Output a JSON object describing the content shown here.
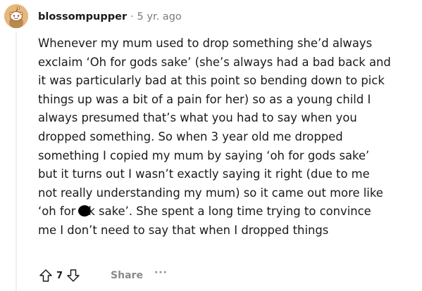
{
  "comment": {
    "username": "blossompupper",
    "separator": "·",
    "timestamp": "5 yr. ago",
    "avatar_icon": "snoo-avatar-icon",
    "body_lines": [
      "Whenever my mum used to drop something she’d always",
      "exclaim ‘Oh for gods sake’ (she’s always had a bad back and",
      "it was particularly bad at this point so bending down to pick",
      "things up was a bit of a pain for her) so as a young child I",
      "always presumed that’s what you had to say when you",
      "dropped something. So when 3 year old me dropped",
      "something I copied my mum by saying ‘oh for gods sake’",
      "but it turns out I wasn’t exactly saying it right (due to me",
      "not really understanding my mum) so it came out more like"
    ],
    "censored_line": {
      "before": "‘oh for f",
      "after": "k sake’. She spent a long time trying to convince"
    },
    "last_line": "me I don’t need to say that when I dropped things",
    "vote_count": "7",
    "share_label": "Share",
    "more_label": "···"
  },
  "colors": {
    "avatar_bg": "#e8b77a",
    "muted_text": "#878a8c",
    "body_text": "#1a1a1b"
  }
}
